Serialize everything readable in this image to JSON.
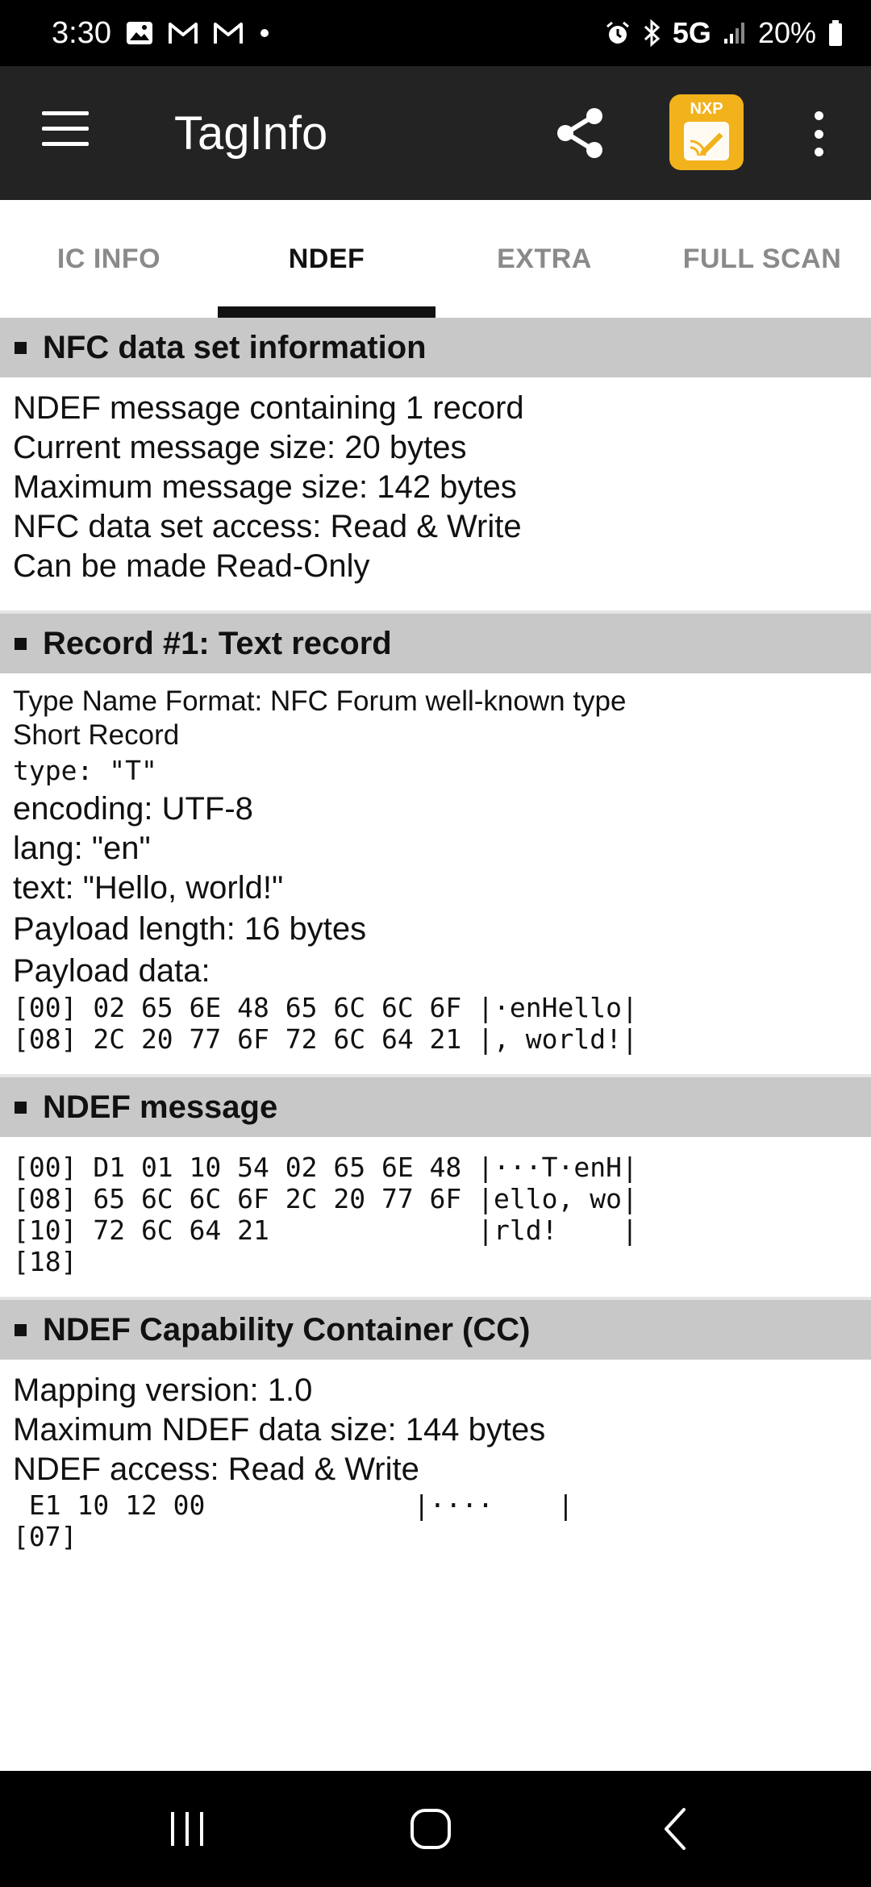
{
  "status": {
    "time": "3:30",
    "network": "5G",
    "battery": "20%",
    "icons": [
      "gallery-icon",
      "gmail-icon",
      "gmail-icon",
      "dot-icon",
      "alarm-icon",
      "bluetooth-icon",
      "signal-icon",
      "battery-icon"
    ]
  },
  "appbar": {
    "title": "TagInfo",
    "badge_text": "NXP",
    "accent": "#f2b21c"
  },
  "tabs": [
    {
      "label": "IC INFO",
      "active": false
    },
    {
      "label": "NDEF",
      "active": true
    },
    {
      "label": "EXTRA",
      "active": false
    },
    {
      "label": "FULL SCAN",
      "active": false
    }
  ],
  "sections": {
    "nfc_info": {
      "title": "NFC data set information",
      "lines": [
        "NDEF message containing 1 record",
        "Current message size: 20 bytes",
        "Maximum message size: 142 bytes",
        "NFC data set access: Read & Write",
        "Can be made Read-Only"
      ]
    },
    "record1": {
      "title": "Record #1: Text record",
      "tnf": "Type Name Format: NFC Forum well-known type",
      "short": "Short Record",
      "type": "type: \"T\"",
      "encoding": "encoding: UTF-8",
      "lang": "lang: \"en\"",
      "text": "text: \"Hello, world!\"",
      "payload_length": "Payload length: 16 bytes",
      "payload_label": "Payload data:",
      "hex": [
        "[00] 02 65 6E 48 65 6C 6C 6F |·enHello|",
        "[08] 2C 20 77 6F 72 6C 64 21 |, world!|"
      ]
    },
    "ndef_message": {
      "title": "NDEF message",
      "hex": [
        "[00] D1 01 10 54 02 65 6E 48 |···T·enH|",
        "[08] 65 6C 6C 6F 2C 20 77 6F |ello, wo|",
        "[10] 72 6C 64 21             |rld!    |",
        "[18]"
      ]
    },
    "cc": {
      "title": "NDEF Capability Container (CC)",
      "lines": [
        "Mapping version: 1.0",
        "Maximum NDEF data size: 144 bytes",
        "NDEF access: Read & Write"
      ],
      "hex": [
        " E1 10 12 00             |····    |",
        "[07]"
      ]
    }
  }
}
